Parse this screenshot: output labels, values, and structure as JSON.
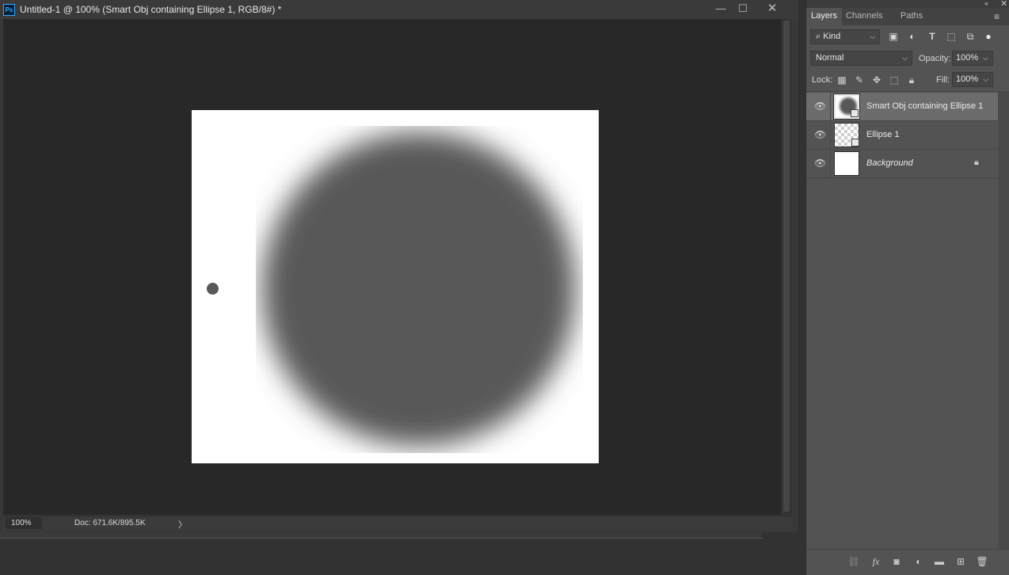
{
  "document": {
    "title": "Untitled-1 @ 100% (Smart Obj containing Ellipse 1, RGB/8#) *",
    "app_logo": "Ps",
    "window_buttons": {
      "minimize": "—",
      "maximize": "☐",
      "close": "✕"
    },
    "zoom": "100%",
    "doc_info": "Doc: 671.6K/895.5K",
    "status_arrow": "〉"
  },
  "canvas": {
    "background": "#ffffff",
    "shape_color": "#595959"
  },
  "panel": {
    "header_icons": {
      "collapse": "«",
      "close": "✕"
    },
    "tabs": [
      {
        "label": "Layers",
        "active": true
      },
      {
        "label": "Channels",
        "active": false
      },
      {
        "label": "Paths",
        "active": false
      }
    ],
    "menu_icon": "≡",
    "filter": {
      "kind": "Kind",
      "kind_icon": "magnifier-icon",
      "icons": [
        "image-filter-icon",
        "adjustment-filter-icon",
        "type-filter-icon",
        "shape-filter-icon",
        "smart-object-filter-icon",
        "filter-toggle-icon"
      ]
    },
    "blend_mode": "Normal",
    "opacity_label": "Opacity:",
    "opacity": "100%",
    "lock_label": "Lock:",
    "lock_icons": [
      "lock-transparent-icon",
      "lock-image-icon",
      "lock-position-icon",
      "lock-artboard-icon",
      "lock-all-icon"
    ],
    "fill_label": "Fill:",
    "fill": "100%",
    "layers": [
      {
        "name": "Smart Obj containing Ellipse 1",
        "selected": true,
        "italic": false,
        "thumb": "smart-object"
      },
      {
        "name": "Ellipse 1",
        "selected": false,
        "italic": false,
        "thumb": "transparent-shape"
      },
      {
        "name": "Background",
        "selected": false,
        "italic": true,
        "thumb": "white",
        "locked": true
      }
    ],
    "footer_icons": [
      "link-layers-icon",
      "fx-icon",
      "layer-mask-icon",
      "adjustment-layer-icon",
      "new-group-icon",
      "new-layer-icon",
      "trash-icon"
    ]
  }
}
